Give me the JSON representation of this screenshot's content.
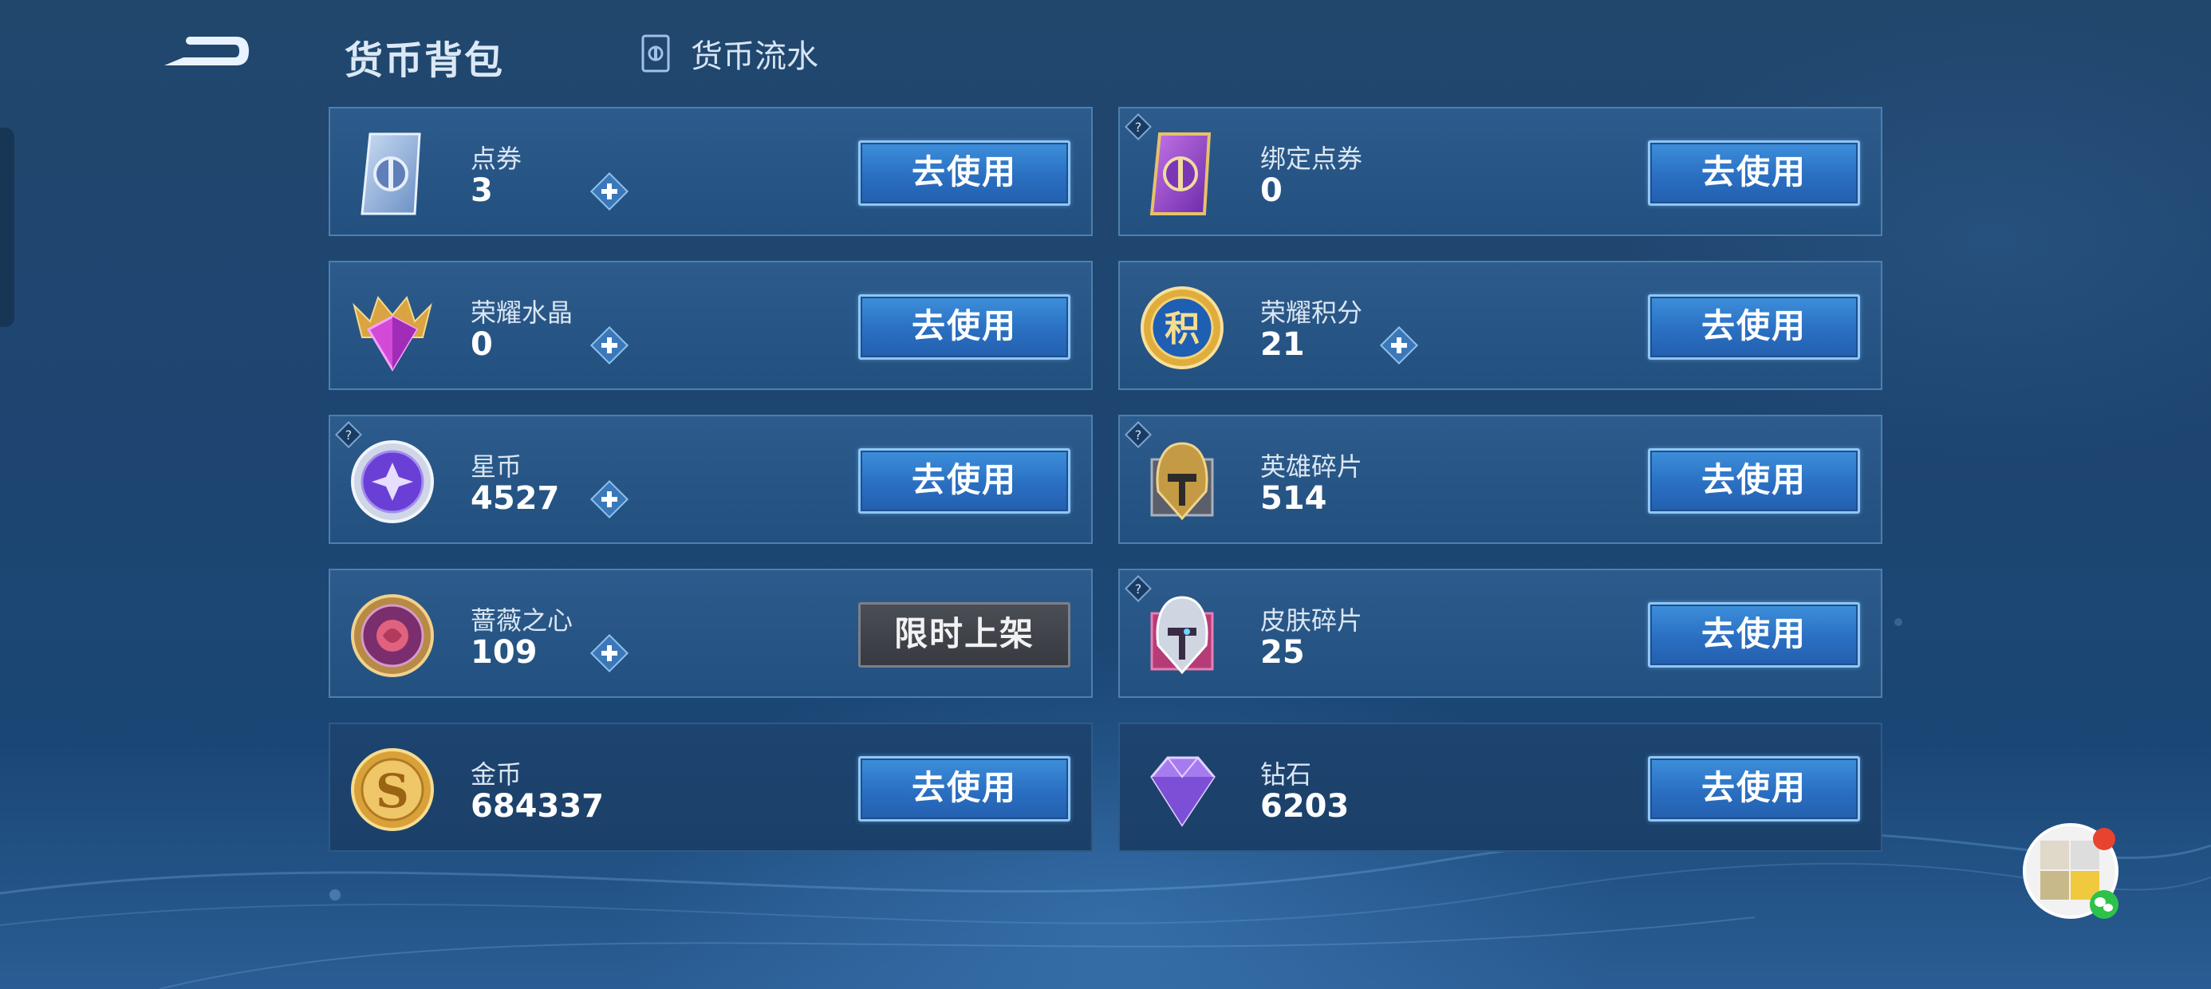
{
  "header": {
    "title": "货币背包",
    "flow_tab_label": "货币流水"
  },
  "colors": {
    "accent_blue": "#2a6fc2",
    "use_button_border": "#8fc6f5",
    "limited_button_bg": "#3f4349",
    "card_bg": "#2c5b8c"
  },
  "cards": [
    {
      "name": "点券",
      "value": "3",
      "icon": "ticket-icon",
      "has_plus": true,
      "help": false,
      "button": "去使用"
    },
    {
      "name": "绑定点券",
      "value": "0",
      "icon": "bound-ticket-icon",
      "has_plus": false,
      "help": true,
      "button": "去使用"
    },
    {
      "name": "荣耀水晶",
      "value": "0",
      "icon": "glory-crystal-icon",
      "has_plus": true,
      "help": false,
      "button": "去使用"
    },
    {
      "name": "荣耀积分",
      "value": "21",
      "icon": "glory-points-icon",
      "has_plus": true,
      "help": false,
      "button": "去使用"
    },
    {
      "name": "星币",
      "value": "4527",
      "icon": "star-coin-icon",
      "has_plus": true,
      "help": true,
      "button": "去使用"
    },
    {
      "name": "英雄碎片",
      "value": "514",
      "icon": "hero-fragment-icon",
      "has_plus": false,
      "help": true,
      "button": "去使用"
    },
    {
      "name": "蔷薇之心",
      "value": "109",
      "icon": "rose-heart-icon",
      "has_plus": true,
      "help": false,
      "button": "限时上架"
    },
    {
      "name": "皮肤碎片",
      "value": "25",
      "icon": "skin-fragment-icon",
      "has_plus": false,
      "help": true,
      "button": "去使用"
    },
    {
      "name": "金币",
      "value": "684337",
      "icon": "gold-coin-icon",
      "has_plus": false,
      "help": false,
      "button": "去使用"
    },
    {
      "name": "钻石",
      "value": "6203",
      "icon": "diamond-icon",
      "has_plus": false,
      "help": false,
      "button": "去使用"
    }
  ],
  "glyphs": {
    "points_char": "积"
  }
}
